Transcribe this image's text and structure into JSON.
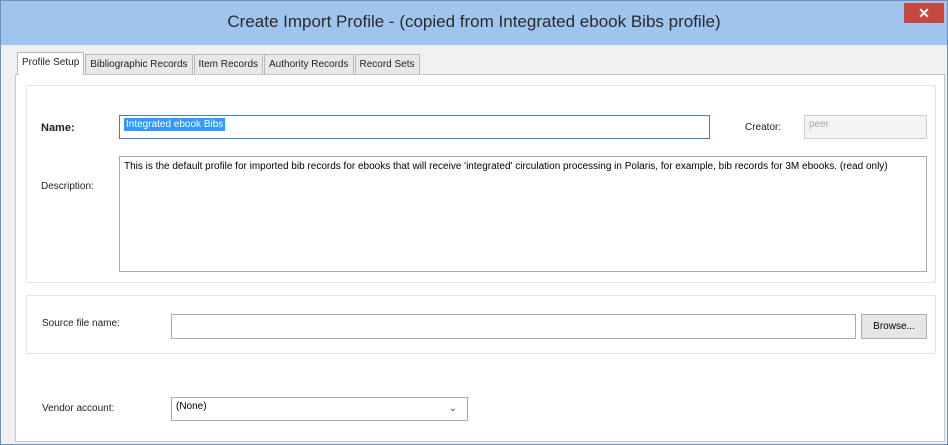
{
  "window": {
    "title": "Create Import Profile - (copied from Integrated ebook Bibs profile)",
    "close_label": "✕"
  },
  "tabs": [
    {
      "label": "Profile Setup",
      "active": true
    },
    {
      "label": "Bibliographic Records",
      "active": false
    },
    {
      "label": "Item Records",
      "active": false
    },
    {
      "label": "Authority Records",
      "active": false
    },
    {
      "label": "Record Sets",
      "active": false
    }
  ],
  "profile": {
    "name_label": "Name:",
    "name_value": "Integrated ebook Bibs",
    "creator_label": "Creator:",
    "creator_value": "peer",
    "description_label": "Description:",
    "description_value": "This is the default profile for imported bib records for ebooks that will receive 'integrated' circulation processing in Polaris, for example, bib records for 3M ebooks. (read only)"
  },
  "source": {
    "label": "Source file name:",
    "value": "",
    "browse_label": "Browse..."
  },
  "vendor": {
    "label": "Vendor account:",
    "selected": "(None)",
    "chevron_icon": "chevron-down-icon"
  }
}
